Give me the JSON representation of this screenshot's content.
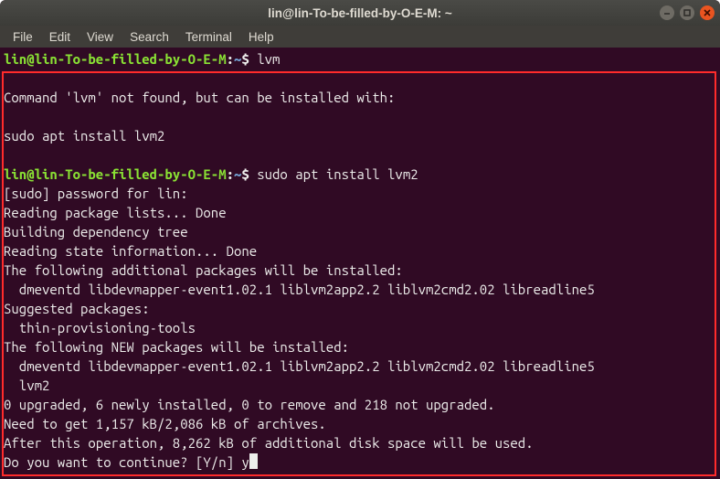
{
  "window": {
    "title": "lin@lin-To-be-filled-by-O-E-M: ~"
  },
  "menu": {
    "file": "File",
    "edit": "Edit",
    "view": "View",
    "search": "Search",
    "terminal": "Terminal",
    "help": "Help"
  },
  "prompt": {
    "user_host": "lin@lin-To-be-filled-by-O-E-M",
    "colon": ":",
    "path": "~",
    "dollar": "$ "
  },
  "lines": {
    "cmd1": "lvm",
    "l1": "",
    "l2": "Command 'lvm' not found, but can be installed with:",
    "l3": "",
    "l4": "sudo apt install lvm2",
    "l5": "",
    "cmd2": "sudo apt install lvm2",
    "l6": "[sudo] password for lin:",
    "l7": "Reading package lists... Done",
    "l8": "Building dependency tree",
    "l9": "Reading state information... Done",
    "l10": "The following additional packages will be installed:",
    "l11": "  dmeventd libdevmapper-event1.02.1 liblvm2app2.2 liblvm2cmd2.02 libreadline5",
    "l12": "Suggested packages:",
    "l13": "  thin-provisioning-tools",
    "l14": "The following NEW packages will be installed:",
    "l15": "  dmeventd libdevmapper-event1.02.1 liblvm2app2.2 liblvm2cmd2.02 libreadline5",
    "l16": "  lvm2",
    "l17": "0 upgraded, 6 newly installed, 0 to remove and 218 not upgraded.",
    "l18": "Need to get 1,157 kB/2,086 kB of archives.",
    "l19": "After this operation, 8,262 kB of additional disk space will be used.",
    "l20": "Do you want to continue? [Y/n] y"
  }
}
